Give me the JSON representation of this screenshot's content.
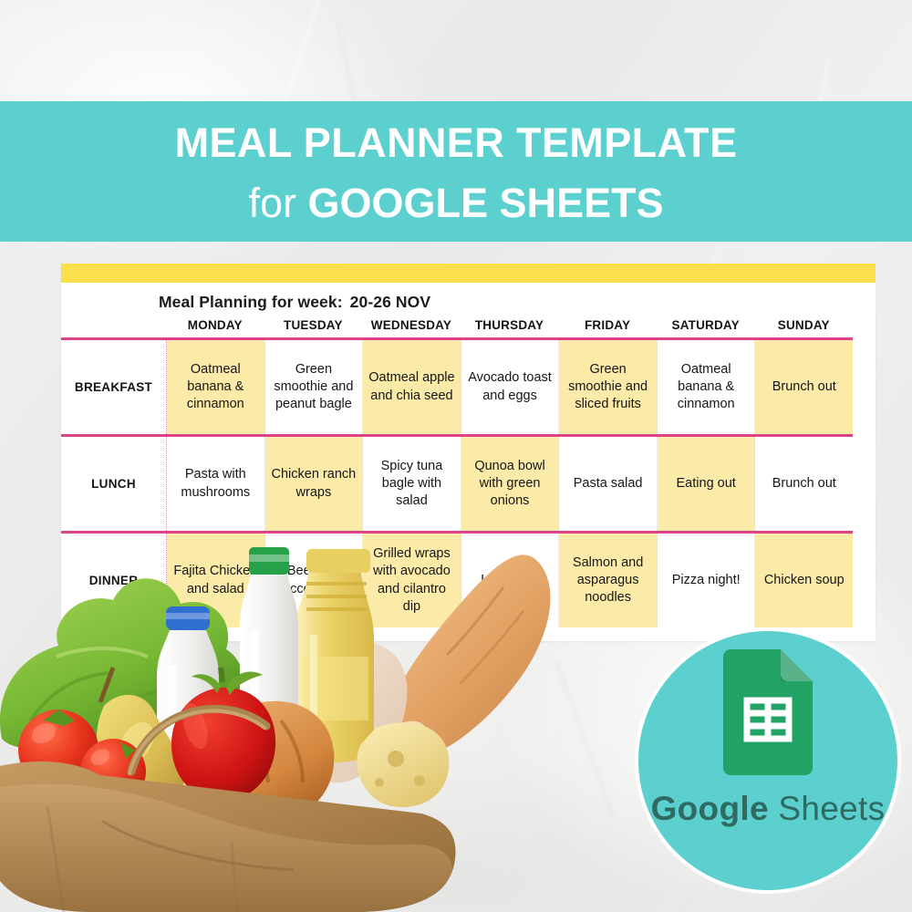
{
  "banner": {
    "line1": "MEAL PLANNER TEMPLATE",
    "line2_light": "for ",
    "line2_bold": "GOOGLE SHEETS"
  },
  "planner": {
    "week_label": "Meal Planning for week:",
    "week_value": "20-26 NOV",
    "days": [
      "MONDAY",
      "TUESDAY",
      "WEDNESDAY",
      "THURSDAY",
      "FRIDAY",
      "SATURDAY",
      "SUNDAY"
    ],
    "rows": [
      {
        "label": "BREAKFAST",
        "cells": [
          "Oatmeal banana & cinnamon",
          "Green smoothie and peanut bagle",
          "Oatmeal apple and chia seed",
          "Avocado toast and eggs",
          "Green smoothie and sliced fruits",
          "Oatmeal banana & cinnamon",
          "Brunch out"
        ],
        "fills": [
          "y",
          "w",
          "y",
          "w",
          "y",
          "w",
          "y"
        ]
      },
      {
        "label": "LUNCH",
        "cells": [
          "Pasta with mushrooms",
          "Chicken ranch wraps",
          "Spicy tuna bagle with salad",
          "Qunoa bowl with green onions",
          "Pasta salad",
          "Eating out",
          "Brunch out"
        ],
        "fills": [
          "w",
          "y",
          "w",
          "y",
          "w",
          "y",
          "w"
        ]
      },
      {
        "label": "DINNER",
        "cells": [
          "Fajita Chicken and salad",
          "Beef and broccoli stir fry",
          "Grilled wraps with avocado and cilantro dip",
          "Lentil chili",
          "Salmon and asparagus noodles",
          "Pizza night!",
          "Chicken soup"
        ],
        "fills": [
          "y",
          "w",
          "y",
          "w",
          "y",
          "w",
          "y"
        ]
      }
    ]
  },
  "badge": {
    "brand_bold": "Google",
    "brand_light": " Sheets",
    "icon": "google-sheets-doc-icon"
  },
  "colors": {
    "teal": "#5cd0ce",
    "yellow_bar": "#fbdf4c",
    "cell_yellow": "#fbeaa8",
    "pink_rule": "#de4289",
    "sheets_green": "#21a366",
    "background": "#ededec"
  },
  "photo": {
    "alt": "grocery-bag-with-vegetables-bread-milk-oil"
  }
}
